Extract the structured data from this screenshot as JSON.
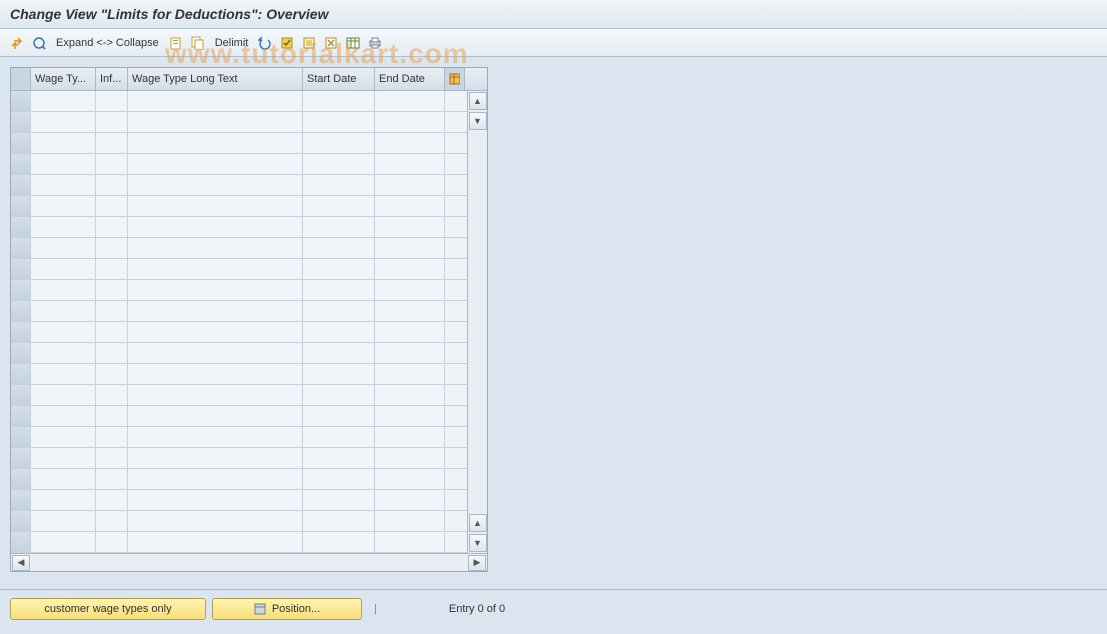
{
  "window": {
    "title": "Change View \"Limits for Deductions\": Overview"
  },
  "toolbar": {
    "expand_label": "Expand <-> Collapse",
    "delimit_label": "Delimit"
  },
  "table": {
    "columns": {
      "c1": "Wage Ty...",
      "c2": "Inf...",
      "c3": "Wage Type Long Text",
      "c4": "Start Date",
      "c5": "End Date"
    },
    "rows": []
  },
  "footer": {
    "customer_btn": "customer wage types only",
    "position_btn": "Position...",
    "status": "Entry 0 of 0"
  },
  "watermark": "www.tutorialkart.com"
}
